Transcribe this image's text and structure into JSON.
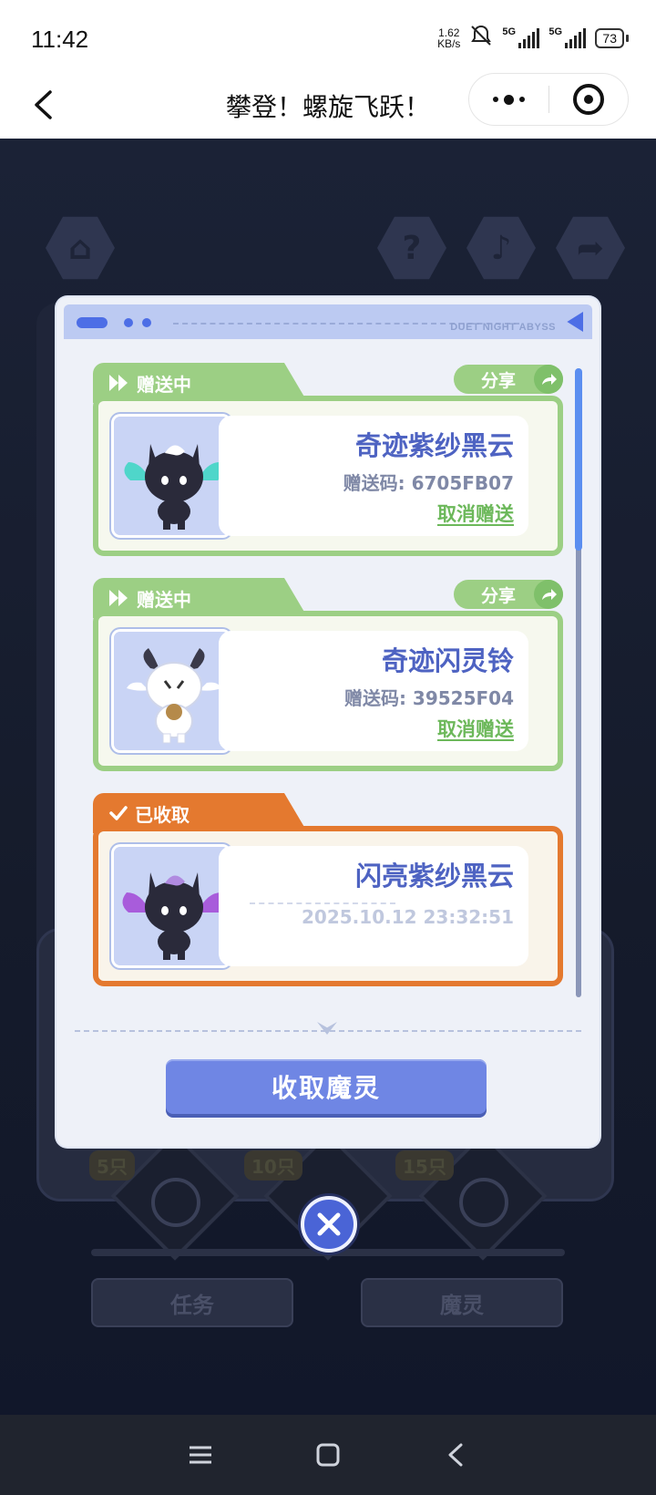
{
  "status_bar": {
    "time": "11:42",
    "net_speed_value": "1.62",
    "net_speed_unit": "KB/s",
    "sim1": "5G",
    "sim2": "5G",
    "battery": "73"
  },
  "title_bar": {
    "title": "攀登！螺旋飞跃！",
    "back_icon": "chevron-left-icon",
    "more_icon": "more-dots-icon",
    "close_icon": "target-circle-icon"
  },
  "dialog": {
    "header_brand": "DUET NIGHT ABYSS",
    "cards": [
      {
        "status_label": "赠送中",
        "status_icon": "fast-forward-icon",
        "share_label": "分享",
        "name": "奇迹紫纱黑云",
        "code": "赠送码: 6705FB07",
        "action": "取消赠送",
        "color": "#9ccf84"
      },
      {
        "status_label": "赠送中",
        "status_icon": "fast-forward-icon",
        "share_label": "分享",
        "name": "奇迹闪灵铃",
        "code": "赠送码: 39525F04",
        "action": "取消赠送",
        "color": "#9ccf84"
      },
      {
        "status_label": "已收取",
        "status_icon": "checkmark-icon",
        "name": "闪亮紫纱黑云",
        "date": "2025.10.12 23:32:51",
        "color": "#e4792f"
      }
    ],
    "collect_button": "收取魔灵"
  },
  "background": {
    "counts": [
      "5只",
      "10只",
      "15只"
    ],
    "tab_task": "任务",
    "tab_spirit": "魔灵"
  },
  "colors": {
    "accent_blue": "#6f86e4",
    "title_blue": "#4e63c2",
    "green": "#9ccf84",
    "orange": "#e4792f"
  }
}
